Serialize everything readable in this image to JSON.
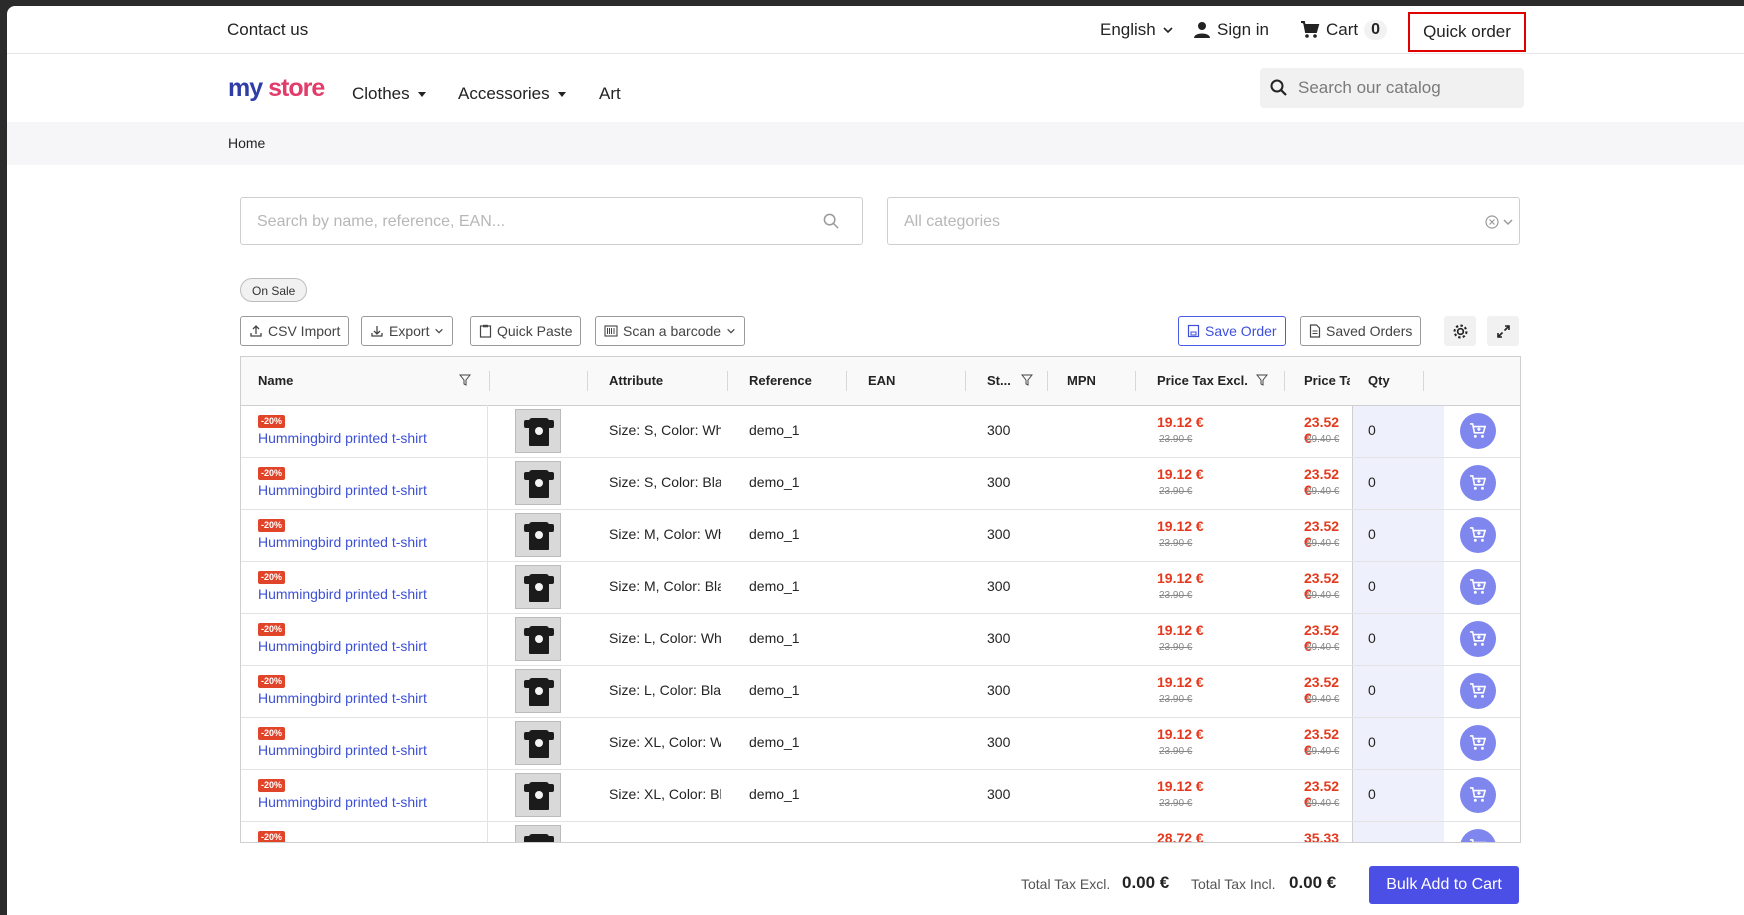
{
  "topbar": {
    "contact": "Contact us",
    "language": "English",
    "sign_in": "Sign in",
    "cart_label": "Cart",
    "cart_count": "0",
    "quick_order": "Quick order"
  },
  "nav": {
    "logo_my": "my",
    "logo_store": "store",
    "items": [
      "Clothes",
      "Accessories",
      "Art"
    ],
    "search_placeholder": "Search our catalog"
  },
  "breadcrumb": "Home",
  "filters": {
    "search_placeholder": "Search by name, reference, EAN...",
    "category_placeholder": "All categories",
    "on_sale_pill": "On Sale"
  },
  "toolbar": {
    "csv_import": "CSV Import",
    "export": "Export",
    "quick_paste": "Quick Paste",
    "scan_barcode": "Scan a barcode",
    "save_order": "Save Order",
    "saved_orders": "Saved Orders"
  },
  "table": {
    "columns": [
      "Name",
      "Attribute",
      "Reference",
      "EAN",
      "St...",
      "MPN",
      "Price Tax Excl.",
      "Price Ta",
      "Qty"
    ],
    "rows": [
      {
        "badge": "-20%",
        "name": "Hummingbird printed t-shirt",
        "attribute": "Size: S, Color: Whit",
        "reference": "demo_1",
        "ean": "",
        "stock": "300",
        "mpn": "",
        "price_excl": "19.12 €",
        "price_excl_old": "23.90 €",
        "price_incl": "23.52 €",
        "price_incl_old": "29.40 €",
        "qty": "0"
      },
      {
        "badge": "-20%",
        "name": "Hummingbird printed t-shirt",
        "attribute": "Size: S, Color: Blac",
        "reference": "demo_1",
        "ean": "",
        "stock": "300",
        "mpn": "",
        "price_excl": "19.12 €",
        "price_excl_old": "23.90 €",
        "price_incl": "23.52 €",
        "price_incl_old": "29.40 €",
        "qty": "0"
      },
      {
        "badge": "-20%",
        "name": "Hummingbird printed t-shirt",
        "attribute": "Size: M, Color: Whi",
        "reference": "demo_1",
        "ean": "",
        "stock": "300",
        "mpn": "",
        "price_excl": "19.12 €",
        "price_excl_old": "23.90 €",
        "price_incl": "23.52 €",
        "price_incl_old": "29.40 €",
        "qty": "0"
      },
      {
        "badge": "-20%",
        "name": "Hummingbird printed t-shirt",
        "attribute": "Size: M, Color: Blac",
        "reference": "demo_1",
        "ean": "",
        "stock": "300",
        "mpn": "",
        "price_excl": "19.12 €",
        "price_excl_old": "23.90 €",
        "price_incl": "23.52 €",
        "price_incl_old": "29.40 €",
        "qty": "0"
      },
      {
        "badge": "-20%",
        "name": "Hummingbird printed t-shirt",
        "attribute": "Size: L, Color: Whit",
        "reference": "demo_1",
        "ean": "",
        "stock": "300",
        "mpn": "",
        "price_excl": "19.12 €",
        "price_excl_old": "23.90 €",
        "price_incl": "23.52 €",
        "price_incl_old": "29.40 €",
        "qty": "0"
      },
      {
        "badge": "-20%",
        "name": "Hummingbird printed t-shirt",
        "attribute": "Size: L, Color: Blac",
        "reference": "demo_1",
        "ean": "",
        "stock": "300",
        "mpn": "",
        "price_excl": "19.12 €",
        "price_excl_old": "23.90 €",
        "price_incl": "23.52 €",
        "price_incl_old": "29.40 €",
        "qty": "0"
      },
      {
        "badge": "-20%",
        "name": "Hummingbird printed t-shirt",
        "attribute": "Size: XL, Color: Wh",
        "reference": "demo_1",
        "ean": "",
        "stock": "300",
        "mpn": "",
        "price_excl": "19.12 €",
        "price_excl_old": "23.90 €",
        "price_incl": "23.52 €",
        "price_incl_old": "29.40 €",
        "qty": "0"
      },
      {
        "badge": "-20%",
        "name": "Hummingbird printed t-shirt",
        "attribute": "Size: XL, Color: Bla",
        "reference": "demo_1",
        "ean": "",
        "stock": "300",
        "mpn": "",
        "price_excl": "19.12 €",
        "price_excl_old": "23.90 €",
        "price_incl": "23.52 €",
        "price_incl_old": "29.40 €",
        "qty": "0"
      },
      {
        "badge": "-20%",
        "name": "",
        "attribute": "",
        "reference": "",
        "ean": "",
        "stock": "",
        "mpn": "",
        "price_excl": "28.72 €",
        "price_excl_old": "",
        "price_incl": "35.33 €",
        "price_incl_old": "",
        "qty": ""
      }
    ]
  },
  "footer": {
    "total_excl_label": "Total Tax Excl.",
    "total_excl_value": "0.00 €",
    "total_incl_label": "Total Tax Incl.",
    "total_incl_value": "0.00 €",
    "bulk_add": "Bulk Add to Cart"
  },
  "colors": {
    "accent": "#4b4fe6",
    "highlight_border": "#e00000",
    "sale_red": "#e5391e",
    "link_blue": "#3d50d6"
  },
  "icons": [
    "chevron-down-icon",
    "user-icon",
    "cart-icon",
    "search-icon",
    "clear-icon",
    "upload-icon",
    "download-icon",
    "clipboard-icon",
    "barcode-icon",
    "save-icon",
    "document-icon",
    "gear-icon",
    "expand-icon",
    "filter-icon",
    "add-to-cart-icon"
  ]
}
